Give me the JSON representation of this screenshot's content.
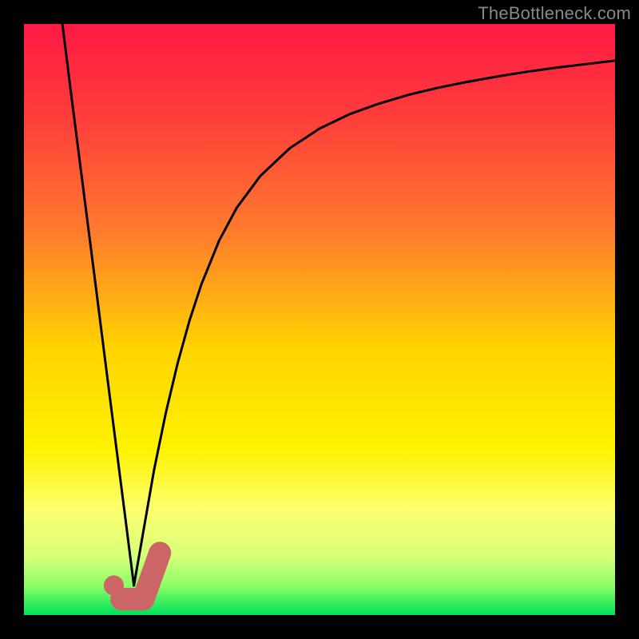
{
  "watermark": "TheBottleneck.com",
  "colors": {
    "frame": "#000000",
    "curve": "#000000",
    "marker": "#cc6666"
  },
  "chart_data": {
    "type": "line",
    "title": "",
    "xlabel": "",
    "ylabel": "",
    "xlim": [
      0,
      100
    ],
    "ylim": [
      0,
      100
    ],
    "grid": false,
    "series": [
      {
        "name": "left-branch",
        "x": [
          6.5,
          8.0,
          10.0,
          12.0,
          14.0,
          16.0,
          17.0,
          18.0,
          18.6
        ],
        "y": [
          100.0,
          88.0,
          72.4,
          56.8,
          41.0,
          25.4,
          17.6,
          9.7,
          5.0
        ]
      },
      {
        "name": "right-branch",
        "x": [
          18.6,
          20.0,
          22.0,
          24.0,
          26.0,
          28.0,
          30.0,
          33.0,
          36.0,
          40.0,
          45.0,
          50.0,
          55.0,
          60.0,
          65.0,
          70.0,
          75.0,
          80.0,
          85.0,
          90.0,
          95.0,
          100.0
        ],
        "y": [
          5.0,
          13.0,
          24.5,
          34.2,
          42.6,
          49.8,
          55.9,
          63.3,
          68.9,
          74.3,
          79.0,
          82.3,
          84.7,
          86.5,
          88.0,
          89.2,
          90.2,
          91.1,
          91.9,
          92.6,
          93.2,
          93.8
        ]
      }
    ],
    "markers": [
      {
        "type": "dot",
        "x": 15.2,
        "y": 5.0,
        "r": 1.7
      },
      {
        "type": "pill",
        "x0": 16.5,
        "y0": 2.7,
        "x1": 20.2,
        "y1": 2.7,
        "r": 1.9
      },
      {
        "type": "pill",
        "x0": 20.2,
        "y0": 2.7,
        "x1": 23.0,
        "y1": 10.5,
        "r": 1.9
      }
    ],
    "gradient_stops": [
      {
        "pct": 0,
        "color": "#ff1a45"
      },
      {
        "pct": 15,
        "color": "#ff3b3b"
      },
      {
        "pct": 35,
        "color": "#ff7a2e"
      },
      {
        "pct": 55,
        "color": "#ffd400"
      },
      {
        "pct": 72,
        "color": "#fff200"
      },
      {
        "pct": 82,
        "color": "#fcff6e"
      },
      {
        "pct": 90,
        "color": "#d8ff7a"
      },
      {
        "pct": 95,
        "color": "#8dff66"
      },
      {
        "pct": 100,
        "color": "#00e05a"
      }
    ]
  }
}
